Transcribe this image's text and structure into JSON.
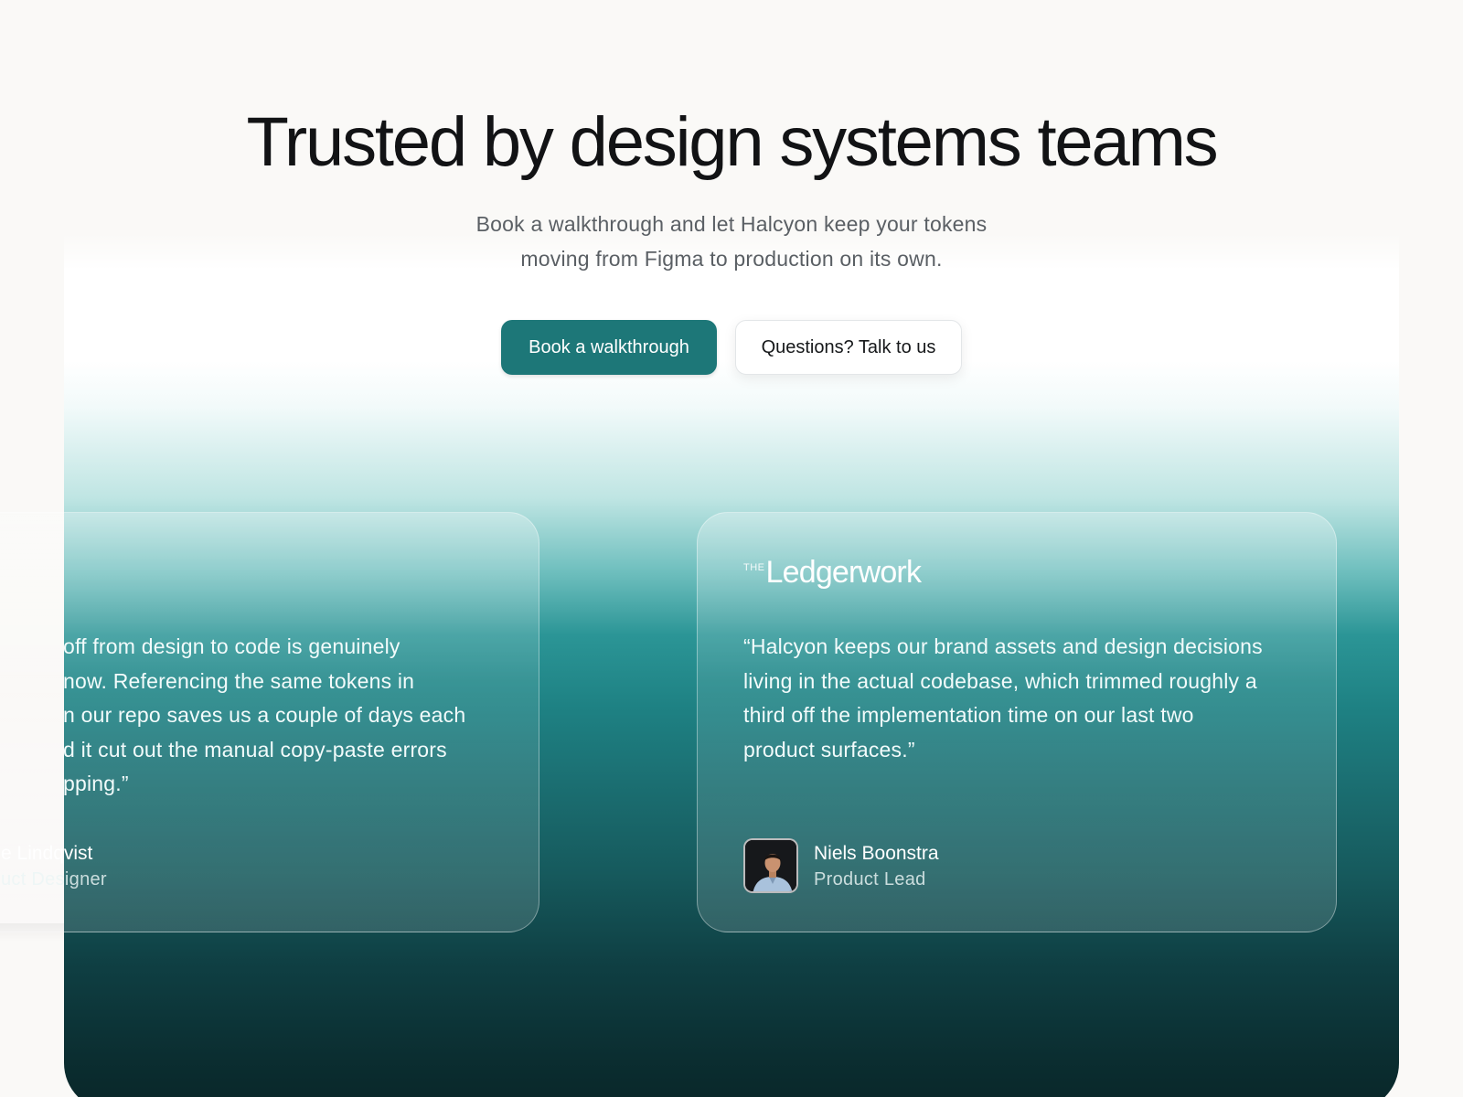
{
  "hero": {
    "title": "Trusted by design systems teams",
    "subtitle_line1": "Book a walkthrough and let Halcyon keep your tokens",
    "subtitle_line2": "moving from Figma to production on its own.",
    "primary_cta": "Book a walkthrough",
    "secondary_cta": "Questions? Talk to us"
  },
  "testimonials": [
    {
      "quote_lines": [
        "off from design to code is genuinely",
        "now. Referencing the same tokens in",
        "n our repo saves us a couple of days each",
        "d it cut out the manual copy-paste errors",
        "pping.”"
      ],
      "author_name": "e Lindqvist",
      "author_role": "uct Designer"
    },
    {
      "logo_prefix": "THE",
      "logo_name": "Ledgerwork",
      "quote_lines": [
        "“Halcyon keeps our brand assets and design decisions",
        "living in the actual codebase, which trimmed roughly a",
        "third off the implementation time on our last two",
        "product surfaces.”"
      ],
      "author_name": "Niels Boonstra",
      "author_role": "Product Lead"
    }
  ],
  "colors": {
    "primary": "#1d7778",
    "heading": "#121315",
    "panel_dark": "#0b2e31"
  }
}
